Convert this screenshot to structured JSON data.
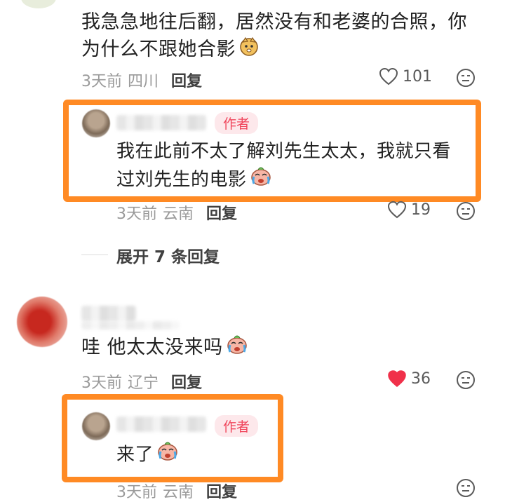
{
  "comments": [
    {
      "text_line1": "我急急地往后翻，居然没有和老婆的合照，你",
      "text_line2": "为什么不跟她合影",
      "time": "3天前",
      "location": "四川",
      "reply_label": "回复",
      "likes": "101",
      "liked": false,
      "reply": {
        "author_tag": "作者",
        "text_line1": "我在此前不太了解刘先生太太，我就只看",
        "text_line2": "过刘先生的电影",
        "time": "3天前",
        "location": "云南",
        "reply_label": "回复",
        "likes": "19",
        "liked": false
      },
      "expand_label": "展开 7 条回复"
    },
    {
      "text": "哇 他太太没来吗",
      "time": "3天前",
      "location": "辽宁",
      "reply_label": "回复",
      "likes": "36",
      "liked": true,
      "reply": {
        "author_tag": "作者",
        "text": "来了",
        "time": "3天前",
        "location": "云南",
        "reply_label": "回复"
      }
    }
  ],
  "colors": {
    "accent_orange": "#ff8a24",
    "like_red": "#f0304a",
    "author_pink": "#f0465c"
  }
}
